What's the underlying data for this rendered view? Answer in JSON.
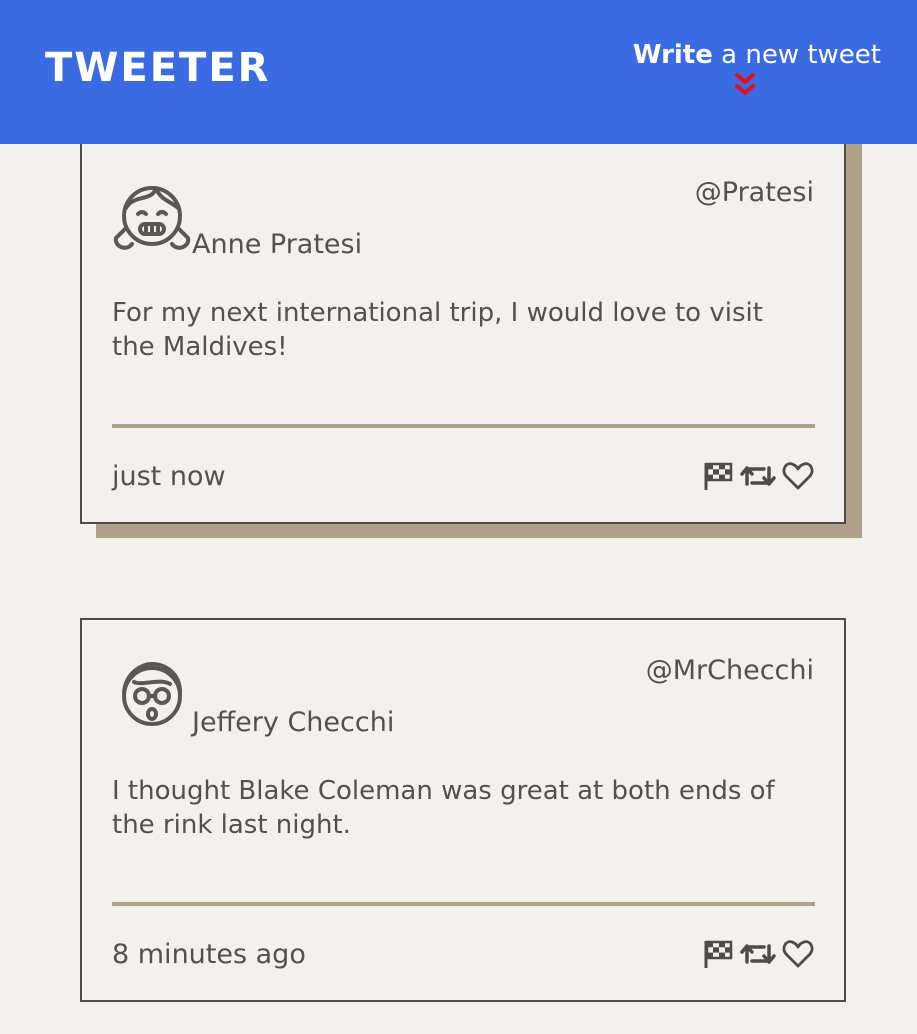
{
  "header": {
    "logo": "TWEETER",
    "compose_bold": "Write",
    "compose_rest": " a new tweet",
    "arrow_icon": "double-chevron-down-icon",
    "arrow_color": "#e0101a"
  },
  "colors": {
    "header_bg": "#3b6be2",
    "page_bg": "#f3f1ed",
    "accent": "#ada18a",
    "text": "#545149"
  },
  "tweets": [
    {
      "name": "Anne Pratesi",
      "handle": "@Pratesi",
      "avatar_icon": "girl-avatar-icon",
      "content": "For my next international trip, I would love to visit the Maldives!",
      "time": "just now",
      "actions": [
        "flag-icon",
        "retweet-icon",
        "heart-icon"
      ]
    },
    {
      "name": "Jeffery Checchi",
      "handle": "@MrChecchi",
      "avatar_icon": "boy-glasses-avatar-icon",
      "content": "I thought Blake Coleman was great at both ends of the rink last night.",
      "time": "8 minutes ago",
      "actions": [
        "flag-icon",
        "retweet-icon",
        "heart-icon"
      ]
    }
  ]
}
